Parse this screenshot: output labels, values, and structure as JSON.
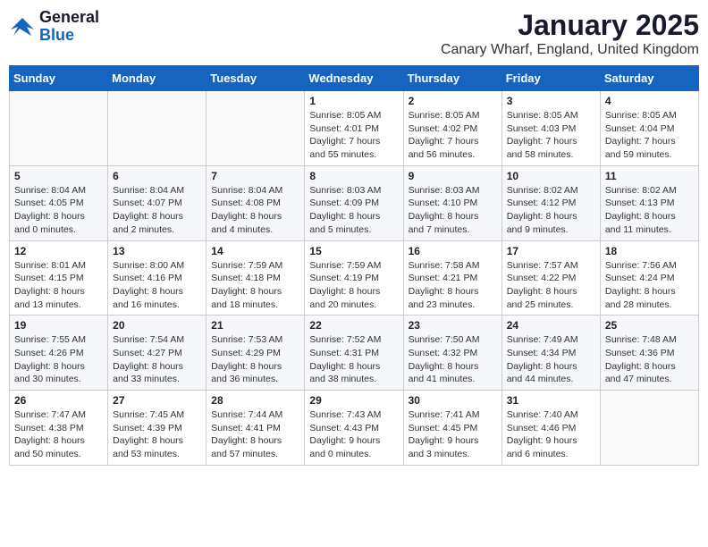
{
  "header": {
    "logo_general": "General",
    "logo_blue": "Blue",
    "title": "January 2025",
    "subtitle": "Canary Wharf, England, United Kingdom"
  },
  "weekdays": [
    "Sunday",
    "Monday",
    "Tuesday",
    "Wednesday",
    "Thursday",
    "Friday",
    "Saturday"
  ],
  "weeks": [
    [
      {
        "day": "",
        "info": ""
      },
      {
        "day": "",
        "info": ""
      },
      {
        "day": "",
        "info": ""
      },
      {
        "day": "1",
        "info": "Sunrise: 8:05 AM\nSunset: 4:01 PM\nDaylight: 7 hours and 55 minutes."
      },
      {
        "day": "2",
        "info": "Sunrise: 8:05 AM\nSunset: 4:02 PM\nDaylight: 7 hours and 56 minutes."
      },
      {
        "day": "3",
        "info": "Sunrise: 8:05 AM\nSunset: 4:03 PM\nDaylight: 7 hours and 58 minutes."
      },
      {
        "day": "4",
        "info": "Sunrise: 8:05 AM\nSunset: 4:04 PM\nDaylight: 7 hours and 59 minutes."
      }
    ],
    [
      {
        "day": "5",
        "info": "Sunrise: 8:04 AM\nSunset: 4:05 PM\nDaylight: 8 hours and 0 minutes."
      },
      {
        "day": "6",
        "info": "Sunrise: 8:04 AM\nSunset: 4:07 PM\nDaylight: 8 hours and 2 minutes."
      },
      {
        "day": "7",
        "info": "Sunrise: 8:04 AM\nSunset: 4:08 PM\nDaylight: 8 hours and 4 minutes."
      },
      {
        "day": "8",
        "info": "Sunrise: 8:03 AM\nSunset: 4:09 PM\nDaylight: 8 hours and 5 minutes."
      },
      {
        "day": "9",
        "info": "Sunrise: 8:03 AM\nSunset: 4:10 PM\nDaylight: 8 hours and 7 minutes."
      },
      {
        "day": "10",
        "info": "Sunrise: 8:02 AM\nSunset: 4:12 PM\nDaylight: 8 hours and 9 minutes."
      },
      {
        "day": "11",
        "info": "Sunrise: 8:02 AM\nSunset: 4:13 PM\nDaylight: 8 hours and 11 minutes."
      }
    ],
    [
      {
        "day": "12",
        "info": "Sunrise: 8:01 AM\nSunset: 4:15 PM\nDaylight: 8 hours and 13 minutes."
      },
      {
        "day": "13",
        "info": "Sunrise: 8:00 AM\nSunset: 4:16 PM\nDaylight: 8 hours and 16 minutes."
      },
      {
        "day": "14",
        "info": "Sunrise: 7:59 AM\nSunset: 4:18 PM\nDaylight: 8 hours and 18 minutes."
      },
      {
        "day": "15",
        "info": "Sunrise: 7:59 AM\nSunset: 4:19 PM\nDaylight: 8 hours and 20 minutes."
      },
      {
        "day": "16",
        "info": "Sunrise: 7:58 AM\nSunset: 4:21 PM\nDaylight: 8 hours and 23 minutes."
      },
      {
        "day": "17",
        "info": "Sunrise: 7:57 AM\nSunset: 4:22 PM\nDaylight: 8 hours and 25 minutes."
      },
      {
        "day": "18",
        "info": "Sunrise: 7:56 AM\nSunset: 4:24 PM\nDaylight: 8 hours and 28 minutes."
      }
    ],
    [
      {
        "day": "19",
        "info": "Sunrise: 7:55 AM\nSunset: 4:26 PM\nDaylight: 8 hours and 30 minutes."
      },
      {
        "day": "20",
        "info": "Sunrise: 7:54 AM\nSunset: 4:27 PM\nDaylight: 8 hours and 33 minutes."
      },
      {
        "day": "21",
        "info": "Sunrise: 7:53 AM\nSunset: 4:29 PM\nDaylight: 8 hours and 36 minutes."
      },
      {
        "day": "22",
        "info": "Sunrise: 7:52 AM\nSunset: 4:31 PM\nDaylight: 8 hours and 38 minutes."
      },
      {
        "day": "23",
        "info": "Sunrise: 7:50 AM\nSunset: 4:32 PM\nDaylight: 8 hours and 41 minutes."
      },
      {
        "day": "24",
        "info": "Sunrise: 7:49 AM\nSunset: 4:34 PM\nDaylight: 8 hours and 44 minutes."
      },
      {
        "day": "25",
        "info": "Sunrise: 7:48 AM\nSunset: 4:36 PM\nDaylight: 8 hours and 47 minutes."
      }
    ],
    [
      {
        "day": "26",
        "info": "Sunrise: 7:47 AM\nSunset: 4:38 PM\nDaylight: 8 hours and 50 minutes."
      },
      {
        "day": "27",
        "info": "Sunrise: 7:45 AM\nSunset: 4:39 PM\nDaylight: 8 hours and 53 minutes."
      },
      {
        "day": "28",
        "info": "Sunrise: 7:44 AM\nSunset: 4:41 PM\nDaylight: 8 hours and 57 minutes."
      },
      {
        "day": "29",
        "info": "Sunrise: 7:43 AM\nSunset: 4:43 PM\nDaylight: 9 hours and 0 minutes."
      },
      {
        "day": "30",
        "info": "Sunrise: 7:41 AM\nSunset: 4:45 PM\nDaylight: 9 hours and 3 minutes."
      },
      {
        "day": "31",
        "info": "Sunrise: 7:40 AM\nSunset: 4:46 PM\nDaylight: 9 hours and 6 minutes."
      },
      {
        "day": "",
        "info": ""
      }
    ]
  ]
}
